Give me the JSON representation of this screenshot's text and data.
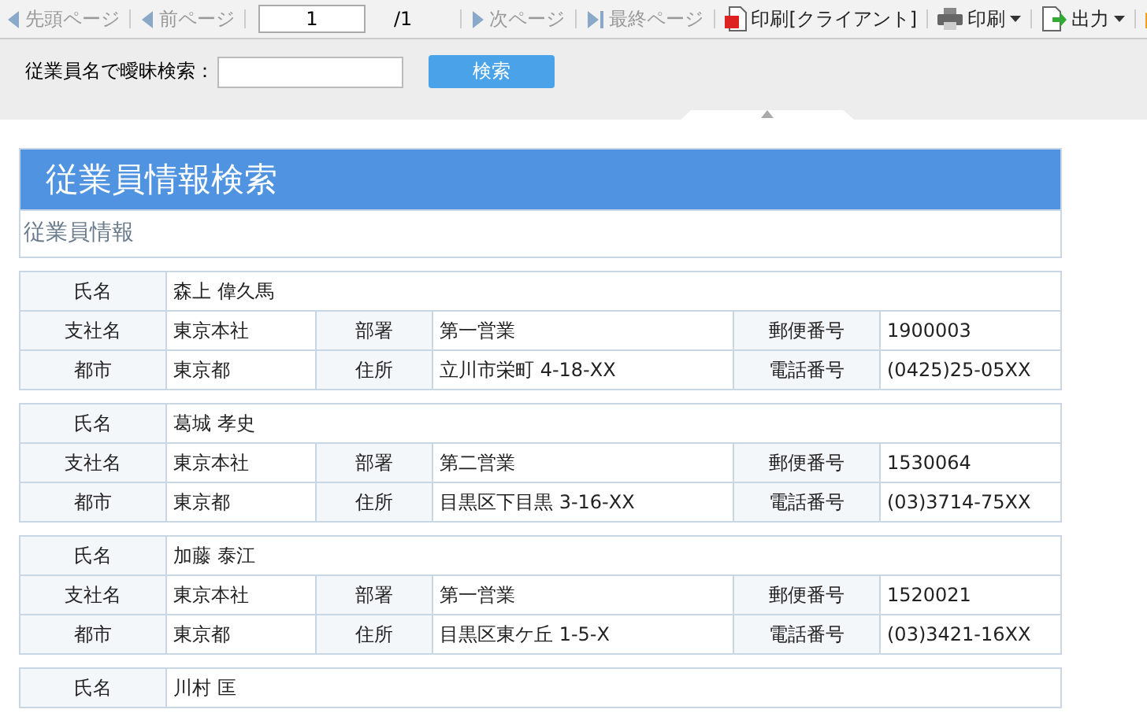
{
  "toolbar": {
    "items": [
      {
        "kind": "nav",
        "label": "先頭ページ",
        "disabled": true
      },
      {
        "kind": "nav",
        "label": "前ページ",
        "disabled": true
      },
      {
        "kind": "page",
        "value": "1",
        "total": "/1"
      },
      {
        "kind": "nav",
        "label": "次ページ",
        "disabled": true
      },
      {
        "kind": "nav",
        "label": "最終ページ",
        "disabled": true
      },
      {
        "kind": "action",
        "label": "印刷[クライアント]",
        "dropdown": false
      },
      {
        "kind": "action",
        "label": "印刷",
        "dropdown": true
      },
      {
        "kind": "action",
        "label": "出力",
        "dropdown": true
      },
      {
        "kind": "action",
        "dropdown": false
      }
    ]
  },
  "search": {
    "label": "従業員名で曖昧検索：",
    "button": "検索"
  },
  "report": {
    "title": "従業員情報検索",
    "subtitle": "従業員情報",
    "employees": [
      {
        "name_label": "氏名",
        "name": "森上 偉久馬",
        "branch_label": "支社名",
        "branch": "東京本社",
        "dept_label": "部署",
        "dept": "第一営業",
        "zip_label": "郵便番号",
        "zip": "1900003",
        "city_label": "都市",
        "city": "東京都",
        "address_label": "住所",
        "address": "立川市栄町 4-18-XX",
        "phone_label": "電話番号",
        "phone": "(0425)25-05XX"
      },
      {
        "name_label": "氏名",
        "name": "葛城 孝史",
        "branch_label": "支社名",
        "branch": "東京本社",
        "dept_label": "部署",
        "dept": "第二営業",
        "zip_label": "郵便番号",
        "zip": "1530064",
        "city_label": "都市",
        "city": "東京都",
        "address_label": "住所",
        "address": "目黒区下目黒 3-16-XX",
        "phone_label": "電話番号",
        "phone": "(03)3714-75XX"
      },
      {
        "name_label": "氏名",
        "name": "加藤 泰江",
        "branch_label": "支社名",
        "branch": "東京本社",
        "dept_label": "部署",
        "dept": "第一営業",
        "zip_label": "郵便番号",
        "zip": "1520021",
        "city_label": "都市",
        "city": "東京都",
        "address_label": "住所",
        "address": "目黒区東ケ丘 1-5-X",
        "phone_label": "電話番号",
        "phone": "(03)3421-16XX"
      },
      {
        "name_label": "氏名",
        "name": "川村 匡"
      }
    ]
  }
}
